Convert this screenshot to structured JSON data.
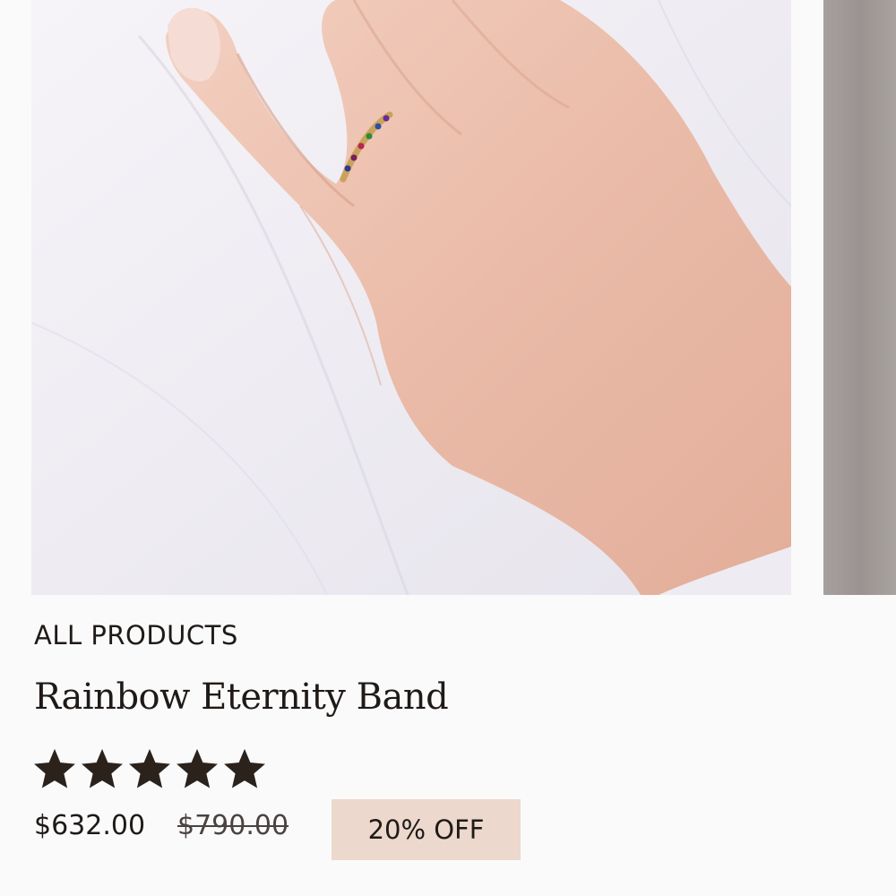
{
  "product": {
    "breadcrumb": "ALL PRODUCTS",
    "title": "Rainbow Eternity Band",
    "rating": {
      "value": 5,
      "max": 5
    },
    "price": {
      "current": "$632.00",
      "original": "$790.00",
      "discount_badge": "20% OFF"
    }
  },
  "gallery": {
    "current_image": "product-photo-hand-with-ring",
    "next_image": "product-photo-next"
  },
  "colors": {
    "background": "#fafafa",
    "text": "#1f1a17",
    "star": "#2b221c",
    "badge_background": "#ecd8cd"
  }
}
